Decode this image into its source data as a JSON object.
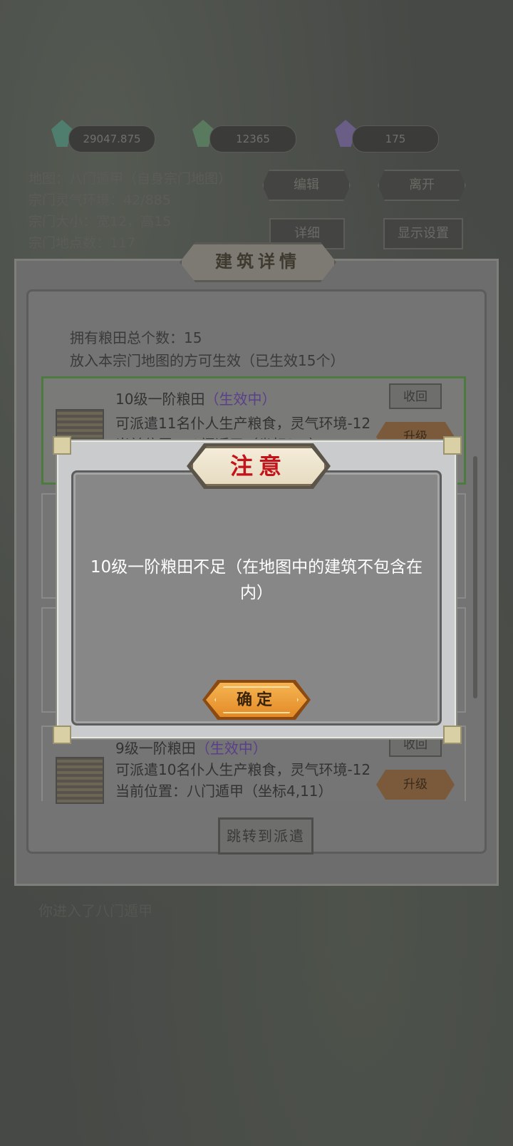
{
  "resources": [
    {
      "value": "29047.875",
      "gem_color": "#4f7d6e"
    },
    {
      "value": "12365",
      "gem_color": "#5a7a60"
    },
    {
      "value": "175",
      "gem_color": "#6a5d86"
    }
  ],
  "sect_info": {
    "map": "地图：八门遁甲（自身宗门地图）",
    "spirit_env": "宗门灵气环境：42/885",
    "size": "宗门大小：宽12，高15",
    "site_count": "宗门地点数：117"
  },
  "top_buttons": {
    "edit": "编辑",
    "leave": "离开",
    "b3": "详细",
    "display_settings": "显示设置"
  },
  "panel": {
    "title": "建筑详情",
    "total_label": "拥有粮田总个数：15",
    "effect_note": "放入本宗门地图的方可生效（已生效15个）"
  },
  "cards": [
    {
      "name": "10级一阶粮田",
      "status": "（生效中）",
      "desc": "可派遣11名仆人生产粮食，灵气环境-12",
      "location": "当前位置：八门遁甲（坐标3,7）",
      "recall": "收回",
      "upgrade": "升级"
    },
    {
      "name": "9级一阶粮田",
      "status": "（生效中）",
      "desc": "可派遣10名仆人生产粮食，灵气环境-12",
      "location": "当前位置：八门遁甲（坐标4,11）",
      "recall": "收回",
      "upgrade": "升级"
    }
  ],
  "jump_button": "跳转到派遣",
  "bottom_message": "你进入了八门遁甲",
  "modal": {
    "title": "注意",
    "message": "10级一阶粮田不足（在地图中的建筑不包含在内）",
    "confirm": "确定"
  }
}
